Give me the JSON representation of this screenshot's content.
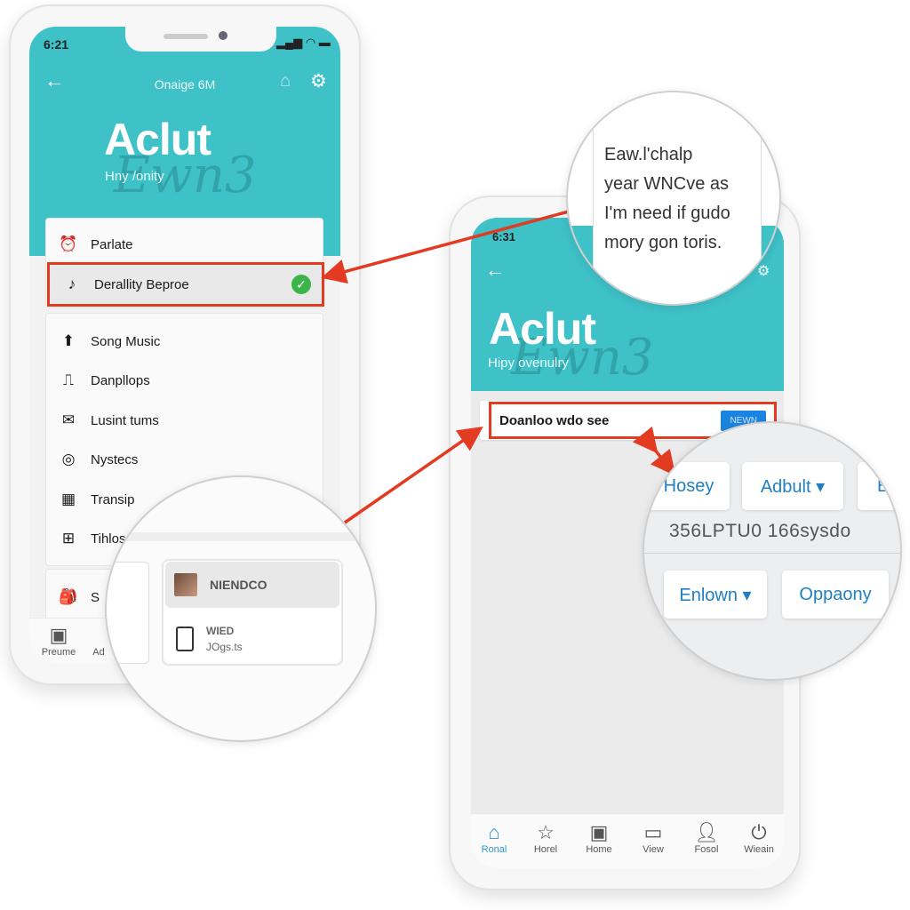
{
  "left_phone": {
    "status_time": "6:21",
    "header_title": "Onaige 6M",
    "hero_title": "Aclut",
    "hero_subtitle": "Hny /onity",
    "watermark": "Ewn3",
    "top_items": [
      {
        "icon": "alarm-icon",
        "label": "Parlate"
      },
      {
        "icon": "music-note-icon",
        "label": "Derallity Beproe",
        "selected": true
      }
    ],
    "items": [
      {
        "icon": "arrow-up-icon",
        "label": "Song Music"
      },
      {
        "icon": "pulse-icon",
        "label": "Danpllops"
      },
      {
        "icon": "mail-icon",
        "label": "Lusint tums"
      },
      {
        "icon": "target-icon",
        "label": "Nystecs"
      },
      {
        "icon": "grid-icon",
        "label": "Transip"
      },
      {
        "icon": "window-icon",
        "label": "Tihlos"
      }
    ],
    "extra_item": {
      "icon": "bag-icon",
      "label": "S"
    },
    "bottom_nav": [
      {
        "icon": "bag-icon",
        "label": "Preume"
      },
      {
        "label": "Ad"
      }
    ]
  },
  "left_zoom": {
    "card1_label": "NIENDCO",
    "card2_title": "WIED",
    "card2_sub": "JOgs.ts"
  },
  "right_phone": {
    "status_time": "6:31",
    "hero_title": "Aclut",
    "hero_subtitle": "Hipy ovenulry",
    "watermark": "Ewn3",
    "search_text": "Doanloo wdo see",
    "search_button": "NEWN",
    "bottom_nav": [
      {
        "icon": "home-icon",
        "label": "Ronal",
        "active": true
      },
      {
        "icon": "star-icon",
        "label": "Horel"
      },
      {
        "icon": "image-icon",
        "label": "Home"
      },
      {
        "icon": "view-icon",
        "label": "View"
      },
      {
        "icon": "user-icon",
        "label": "Fosol"
      },
      {
        "icon": "power-icon",
        "label": "Wiеain"
      }
    ]
  },
  "top_zoom": {
    "lines": [
      "Eaw.l'chalp",
      "year WNCve as",
      "I'm need if gudo",
      "mory gon toris."
    ]
  },
  "right_zoom": {
    "buttons_row1": [
      "Hosey",
      "Adbult ▾",
      "E"
    ],
    "code_text": "356LPTU0 166sysdo",
    "buttons_row2": [
      "Enlown ▾",
      "Oppaony"
    ]
  },
  "colors": {
    "teal": "#3ec1c7",
    "highlight": "#e23b22",
    "accent_blue": "#1f7fc2",
    "check_green": "#3bb54a"
  }
}
